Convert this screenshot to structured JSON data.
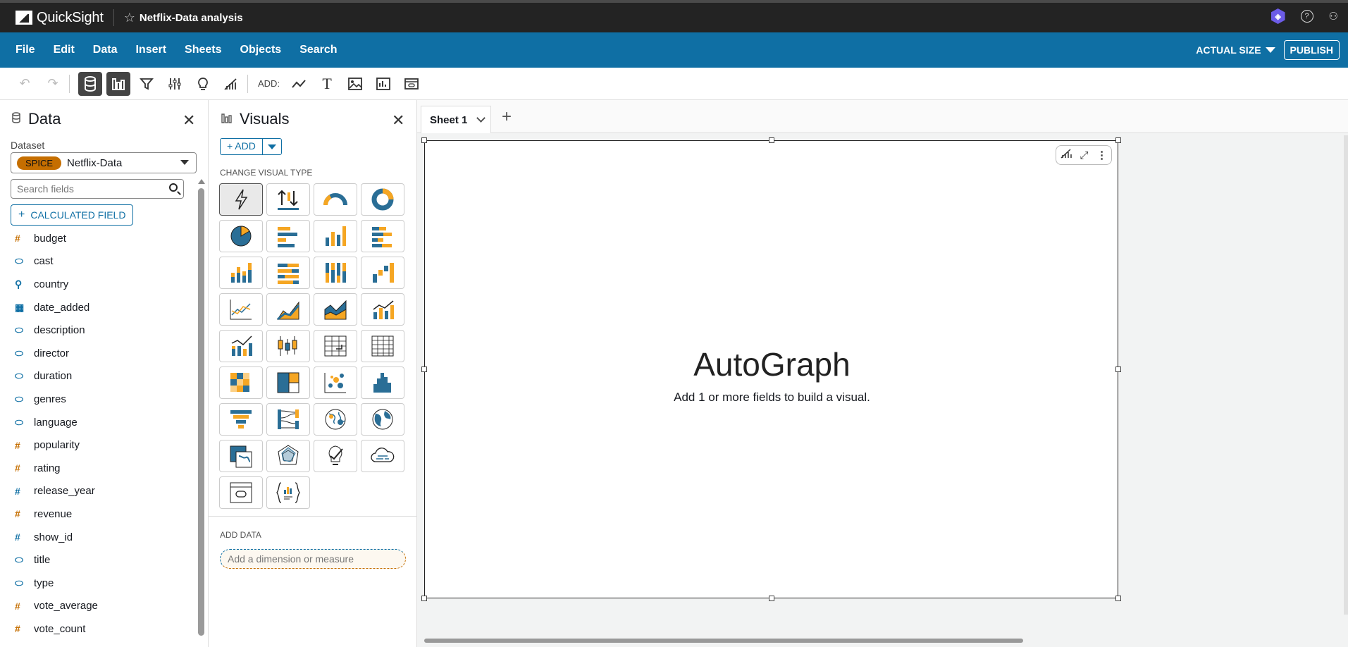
{
  "app": {
    "name": "QuickSight",
    "analysis_title": "Netflix-Data analysis"
  },
  "menu": {
    "items": [
      "File",
      "Edit",
      "Data",
      "Insert",
      "Sheets",
      "Objects",
      "Search"
    ],
    "size_label": "ACTUAL SIZE",
    "publish_label": "PUBLISH"
  },
  "toolbar": {
    "add_label": "ADD:"
  },
  "data_panel": {
    "title": "Data",
    "dataset_label": "Dataset",
    "spice_badge": "SPICE",
    "dataset_name": "Netflix-Data",
    "search_placeholder": "Search fields",
    "calc_label": "CALCULATED FIELD",
    "fields": [
      {
        "name": "budget",
        "kind": "measure",
        "icon": "#"
      },
      {
        "name": "cast",
        "kind": "dim",
        "icon": "tag-icon"
      },
      {
        "name": "country",
        "kind": "dim",
        "icon": "location-icon"
      },
      {
        "name": "date_added",
        "kind": "dim",
        "icon": "calendar-icon"
      },
      {
        "name": "description",
        "kind": "dim",
        "icon": "tag-icon"
      },
      {
        "name": "director",
        "kind": "dim",
        "icon": "tag-icon"
      },
      {
        "name": "duration",
        "kind": "dim",
        "icon": "tag-icon"
      },
      {
        "name": "genres",
        "kind": "dim",
        "icon": "tag-icon"
      },
      {
        "name": "language",
        "kind": "dim",
        "icon": "tag-icon"
      },
      {
        "name": "popularity",
        "kind": "measure",
        "icon": "#"
      },
      {
        "name": "rating",
        "kind": "measure",
        "icon": "#"
      },
      {
        "name": "release_year",
        "kind": "dim",
        "icon": "#"
      },
      {
        "name": "revenue",
        "kind": "measure",
        "icon": "#"
      },
      {
        "name": "show_id",
        "kind": "dim",
        "icon": "#"
      },
      {
        "name": "title",
        "kind": "dim",
        "icon": "tag-icon"
      },
      {
        "name": "type",
        "kind": "dim",
        "icon": "tag-icon"
      },
      {
        "name": "vote_average",
        "kind": "measure",
        "icon": "#"
      },
      {
        "name": "vote_count",
        "kind": "measure",
        "icon": "#"
      }
    ]
  },
  "visuals_panel": {
    "title": "Visuals",
    "add_label": "+ ADD",
    "change_type_label": "CHANGE VISUAL TYPE",
    "add_data_label": "ADD DATA",
    "drop_placeholder": "Add a dimension or measure",
    "types": [
      "autograph",
      "kpi",
      "gauge",
      "donut",
      "pie",
      "horizontal-bar",
      "vertical-bar",
      "horizontal-stacked-bar",
      "vertical-stacked-bar",
      "horizontal-100-stacked",
      "vertical-100-stacked",
      "waterfall",
      "line",
      "area",
      "stacked-area",
      "combo-bar-line",
      "combo-stacked",
      "box-plot",
      "pivot-table",
      "table",
      "heat-map",
      "tree-map",
      "scatter",
      "histogram",
      "funnel",
      "sankey",
      "points-map",
      "filled-map",
      "layer-map",
      "radar",
      "insight",
      "word-cloud",
      "embed",
      "custom-visual"
    ]
  },
  "sheet": {
    "tab_label": "Sheet 1",
    "visual_title": "AutoGraph",
    "visual_hint": "Add 1 or more fields to build a visual."
  },
  "colors": {
    "topbar": "#232323",
    "menubar": "#0f6fa4",
    "accent_orange": "#c56e00",
    "viz_blue": "#2a6e96",
    "viz_orange": "#f5a623"
  }
}
